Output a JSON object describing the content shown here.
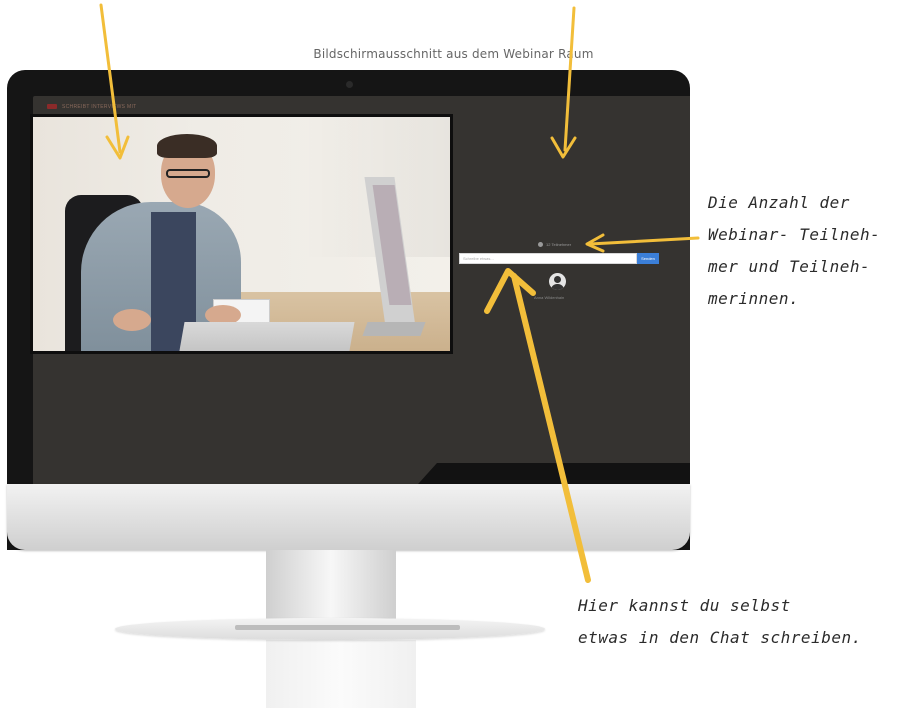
{
  "caption": "Bildschirmausschnitt aus dem Webinar Raum",
  "webinar": {
    "room_title": "SCHREIBT INTERVIEWS MIT",
    "participant_count": "12 Teilnehmer",
    "chat_placeholder": "Schreibe etwas...",
    "send_label": "Senden",
    "attendee_name": "Anna Wildenhain"
  },
  "annotations": {
    "participants": [
      "Die Anzahl der",
      "Webinar- Teilneh-",
      "mer und Teilneh-",
      "merinnen."
    ],
    "chat": [
      "Hier kannst du selbst",
      "etwas in den Chat schreiben."
    ]
  },
  "colors": {
    "arrow": "#F2BE3A",
    "screen": "#353330",
    "bezel": "#151515",
    "send_button": "#3B7FD8"
  }
}
